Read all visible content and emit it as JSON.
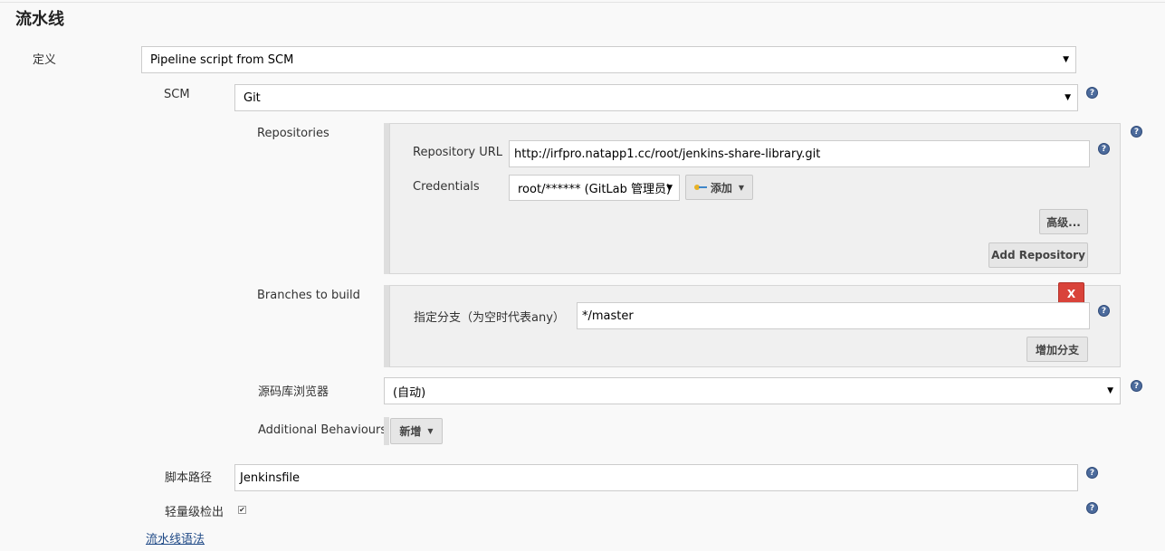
{
  "section": {
    "title": "流水线"
  },
  "definition": {
    "label": "定义",
    "value": "Pipeline script from SCM"
  },
  "scm": {
    "label": "SCM",
    "value": "Git"
  },
  "repositories": {
    "label": "Repositories",
    "url_label": "Repository URL",
    "url_value": "http://irfpro.natapp1.cc/root/jenkins-share-library.git",
    "credentials_label": "Credentials",
    "credentials_value": "root/****** (GitLab 管理员)",
    "add_button": "添加",
    "advanced_button": "高级...",
    "add_repository_button": "Add Repository"
  },
  "branches": {
    "label": "Branches to build",
    "delete_button": "X",
    "branch_label": "指定分支（为空时代表any）",
    "branch_value": "*/master",
    "add_branch_button": "增加分支"
  },
  "repo_browser": {
    "label": "源码库浏览器",
    "value": "(自动)"
  },
  "additional_behaviours": {
    "label": "Additional Behaviours",
    "add_button": "新增"
  },
  "script_path": {
    "label": "脚本路径",
    "value": "Jenkinsfile"
  },
  "lightweight_checkout": {
    "label": "轻量级检出",
    "checked": true
  },
  "pipeline_syntax_link": "流水线语法",
  "icons": {
    "help": "help-icon",
    "caret": "caret-down-icon",
    "key": "key-icon"
  },
  "colors": {
    "help_icon": "#4c6b9c",
    "delete_button": "#d9433a",
    "link": "#204a87"
  }
}
